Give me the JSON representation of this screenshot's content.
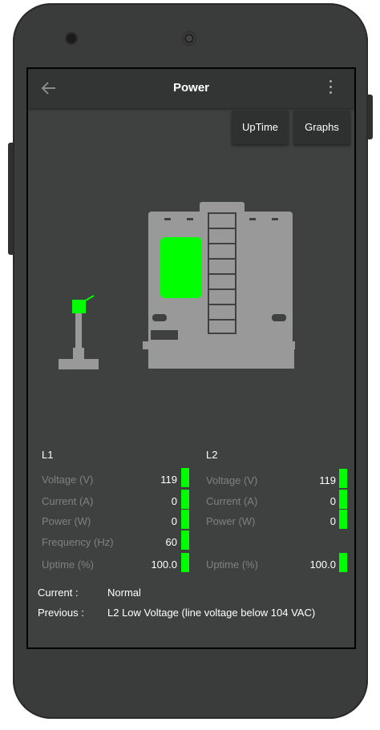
{
  "app": {
    "title": "Power",
    "buttons": {
      "uptime": "UpTime",
      "graphs": "Graphs"
    }
  },
  "icons": {
    "back": "arrow-left-icon",
    "more": "more-vert-icon"
  },
  "colors": {
    "ok": "#00ff00",
    "rv_body": "#999999",
    "label": "#808080"
  },
  "l1": {
    "heading": "L1",
    "rows": [
      {
        "label": "Voltage (V)",
        "value": "119",
        "bar": true
      },
      {
        "label": "Current (A)",
        "value": "0",
        "bar": true
      },
      {
        "label": "Power (W)",
        "value": "0",
        "bar": true
      },
      {
        "label": "Frequency (Hz)",
        "value": "60",
        "bar": true
      },
      {
        "label": "Uptime (%)",
        "value": "100.0",
        "bar": true
      }
    ]
  },
  "l2": {
    "heading": "L2",
    "rows": [
      {
        "label": "Voltage (V)",
        "value": "119",
        "bar": true
      },
      {
        "label": "Current (A)",
        "value": "0",
        "bar": true
      },
      {
        "label": "Power (W)",
        "value": "0",
        "bar": true
      },
      {
        "label": "Uptime (%)",
        "value": "100.0",
        "bar": true
      }
    ]
  },
  "status": {
    "current_label": "Current :",
    "current_value": "Normal",
    "previous_label": "Previous :",
    "previous_value": "L2 Low Voltage (line voltage below 104 VAC)"
  }
}
